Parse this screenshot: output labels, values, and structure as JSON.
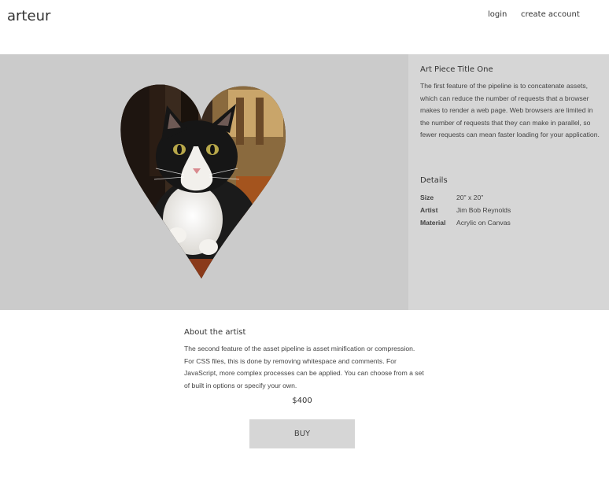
{
  "header": {
    "brand": "arteur",
    "nav": {
      "login": "login",
      "create_account": "create account"
    }
  },
  "art_piece": {
    "image_icon": "heart-shaped-cat-photo",
    "title": "Art Piece Title One",
    "description": "The first feature of the pipeline is to concatenate assets, which can reduce the number of requests that a browser makes to render a web page. Web browsers are limited in the number of requests that they can make in parallel, so fewer requests can mean faster loading for your application.",
    "details_title": "Details",
    "details": [
      {
        "label": "Size",
        "value": "20\" x 20\""
      },
      {
        "label": "Artist",
        "value": "Jim Bob Reynolds"
      },
      {
        "label": "Material",
        "value": "Acrylic on Canvas"
      }
    ]
  },
  "about": {
    "title": "About the artist",
    "text": "The second feature of the asset pipeline is asset minification or compression. For CSS files, this is done by removing whitespace and comments. For JavaScript, more complex processes can be applied. You can choose from a set of built in options or specify your own."
  },
  "purchase": {
    "price": "$400",
    "buy_label": "BUY"
  },
  "colors": {
    "hero_left_bg": "#cbcbcb",
    "hero_right_bg": "#d6d6d6",
    "button_bg": "#d6d6d6"
  }
}
